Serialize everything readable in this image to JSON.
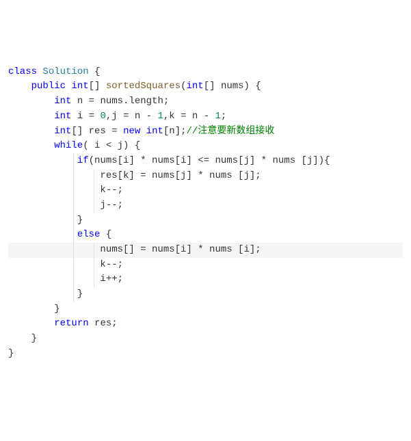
{
  "code": {
    "l1_class": "class",
    "l1_name": "Solution",
    "l1_brace": " {",
    "l2_public": "public",
    "l2_int": "int",
    "l2_method": "sortedSquares",
    "l2_int2": "int",
    "l2_param": "nums",
    "l3_int": "int",
    "l3_rest": " n = nums.length;",
    "l4_int": "int",
    "l4_rest1": " i = ",
    "l4_0": "0",
    "l4_rest2": ",j = n - ",
    "l4_1a": "1",
    "l4_rest3": ",k = n - ",
    "l4_1b": "1",
    "l4_semi": ";",
    "l5_int": "int",
    "l5_rest1": "[] res = ",
    "l5_new": "new",
    "l5_int2": "int",
    "l5_rest2": "[n];",
    "l5_comment": "//注意要新数组接收",
    "l6_while": "while",
    "l6_rest": "( i < j) {",
    "l7_if": "if",
    "l7_rest": "(nums[i] * nums[i] <= nums[j] * nums [j]){",
    "l8": "res[k] = nums[j] * nums [j];",
    "l9": "k--;",
    "l10": "j--;",
    "l11": "}",
    "l12_else": "else",
    "l12_rest": " {",
    "l13": "nums[] = nums[i] * nums [i];",
    "l14": "k--;",
    "l15": "i++;",
    "l16": "}",
    "l17": "}",
    "l18_return": "return",
    "l18_rest": " res;",
    "l19": "}",
    "l20": "}"
  }
}
